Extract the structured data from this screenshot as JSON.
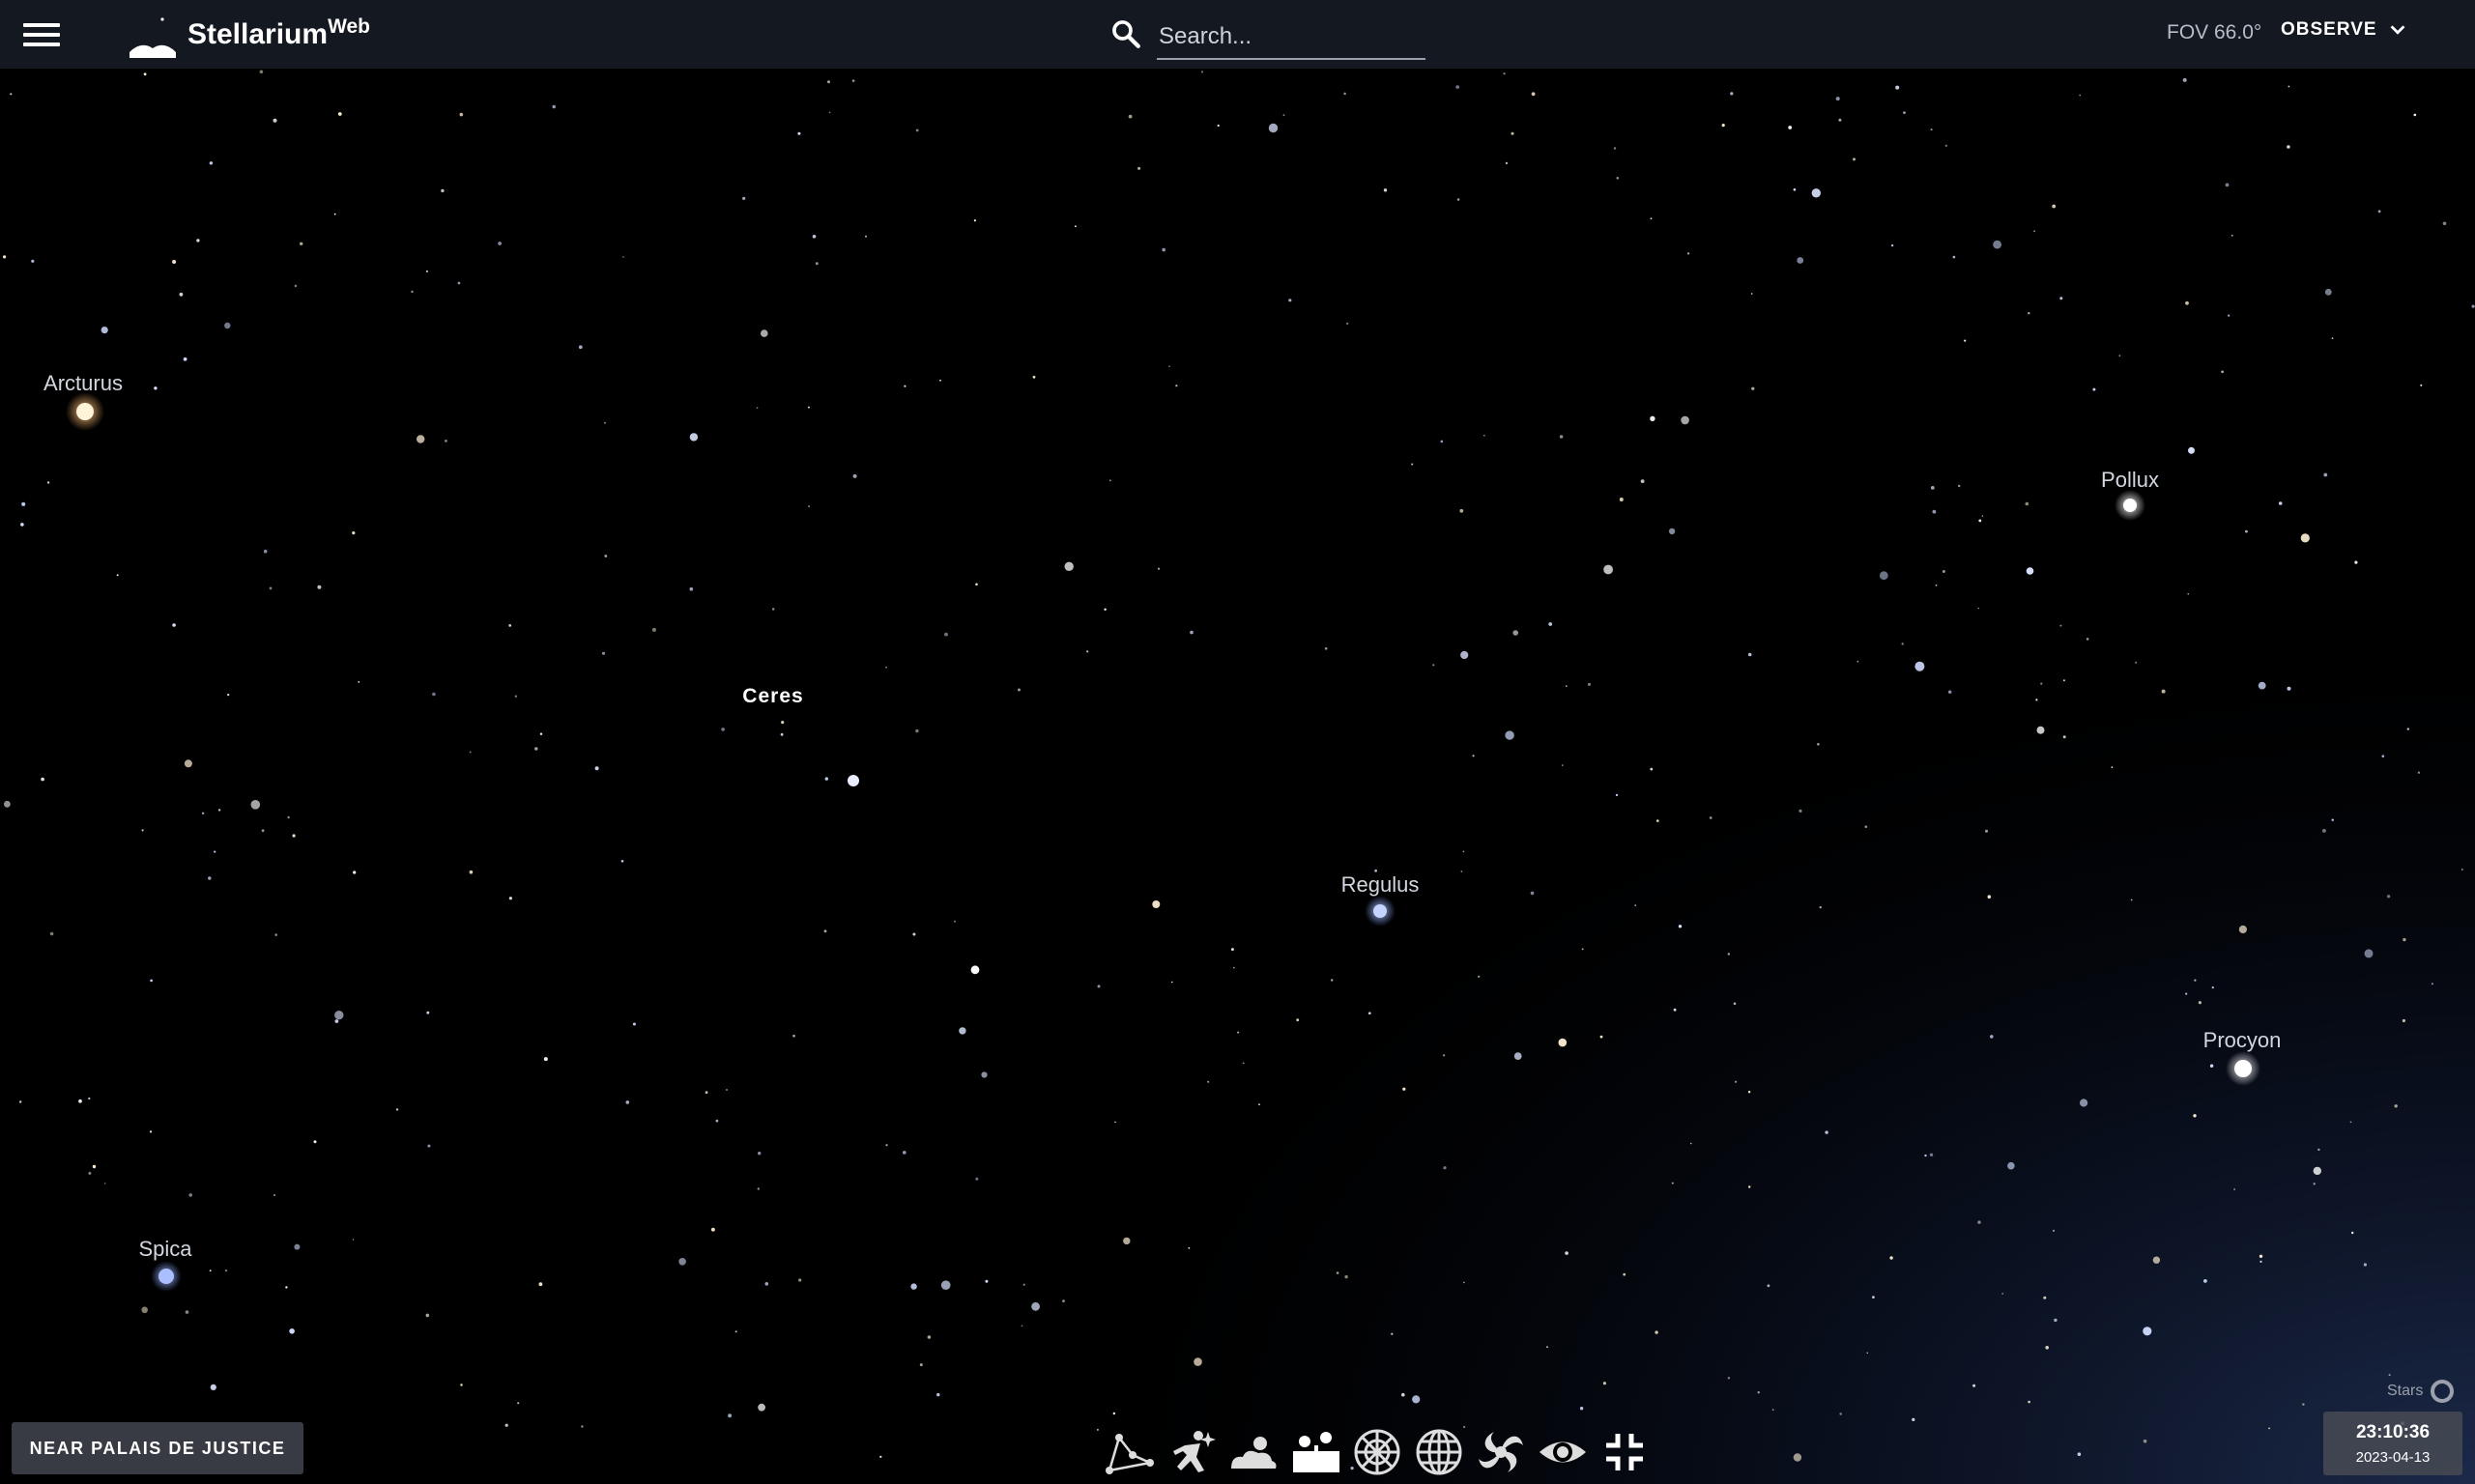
{
  "app": {
    "title": "Stellarium",
    "title_sup": "Web"
  },
  "search": {
    "placeholder": "Search..."
  },
  "header": {
    "fov": "FOV 66.0°",
    "observe_label": "OBSERVE"
  },
  "sky_labels": {
    "arcturus": "Arcturus",
    "pollux": "Pollux",
    "ceres": "Ceres",
    "regulus": "Regulus",
    "procyon": "Procyon",
    "spica": "Spica"
  },
  "footer": {
    "location": "NEAR PALAIS DE JUSTICE",
    "stars_label": "Stars",
    "time": "23:10:36",
    "date": "2023-04-13"
  },
  "toolbar": {
    "buttons": [
      {
        "name": "constellations-lines-icon",
        "active": false
      },
      {
        "name": "constellations-art-icon",
        "active": false
      },
      {
        "name": "atmosphere-icon",
        "active": false
      },
      {
        "name": "landscape-icon",
        "active": true
      },
      {
        "name": "azimuthal-grid-icon",
        "active": false
      },
      {
        "name": "equatorial-grid-icon",
        "active": false
      },
      {
        "name": "deep-sky-objects-icon",
        "active": false
      },
      {
        "name": "night-mode-icon",
        "active": false
      },
      {
        "name": "fullscreen-exit-icon",
        "active": true
      }
    ]
  },
  "colors": {
    "topbar": "#161a24",
    "sky": "#000000",
    "button_bg": "#464a54"
  }
}
